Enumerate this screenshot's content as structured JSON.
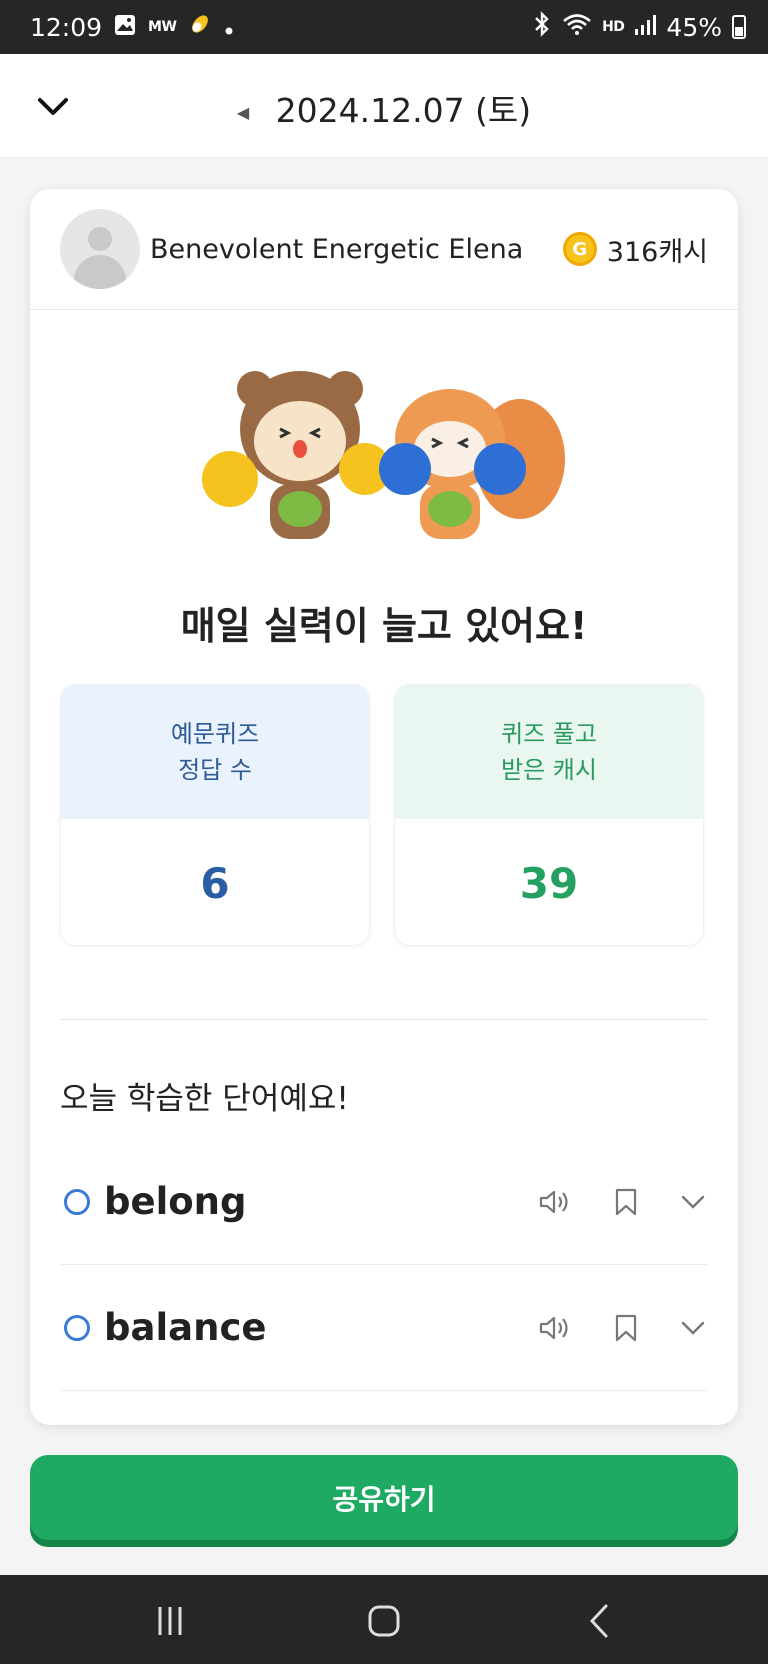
{
  "status_bar": {
    "time": "12:09",
    "carrier_badge": "MW",
    "hd_voice": "HD",
    "battery": "45%",
    "icons": [
      "gallery-icon",
      "app-icon",
      "dot-icon",
      "bluetooth-icon",
      "wifi-icon",
      "hd-voice-icon",
      "signal-icon",
      "battery-icon"
    ]
  },
  "header": {
    "date": "2024.12.07 (토)",
    "collapse_icon": "chevron-down-icon",
    "prev_icon": "caret-left-icon"
  },
  "profile": {
    "username": "Benevolent Energetic Elena",
    "coin_label": "G",
    "cash": "316캐시"
  },
  "headline": "매일 실력이 늘고 있어요!",
  "stats": [
    {
      "label_line1": "예문퀴즈",
      "label_line2": "정답 수",
      "value": "6"
    },
    {
      "label_line1": "퀴즈 풀고",
      "label_line2": "받은 캐시",
      "value": "39"
    }
  ],
  "words_section": {
    "title": "오늘 학습한 단어예요!",
    "words": [
      {
        "word": "belong"
      },
      {
        "word": "balance"
      }
    ]
  },
  "share_button": "공유하기",
  "colors": {
    "accent_green": "#1eaa62",
    "accent_blue": "#2a5ea4",
    "coin_yellow": "#f8c21d"
  }
}
